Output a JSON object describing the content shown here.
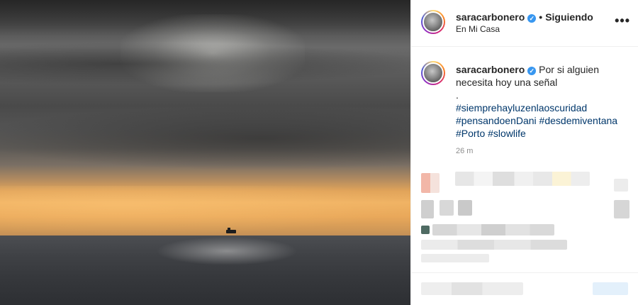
{
  "post": {
    "header": {
      "username": "saracarbonero",
      "follow_status": "Siguiendo",
      "location": "En Mi Casa",
      "more_icon": "•••"
    },
    "caption": {
      "username": "saracarbonero",
      "text": "Por si alguien necesita hoy una señal",
      "separator": ".",
      "hashtags": [
        "#siemprehayluzenlaoscuridad",
        "#pensandoenDani",
        "#desdemiventana",
        "#Porto",
        "#slowlife"
      ],
      "time": "26 m"
    },
    "icons": {
      "verified": "verified-badge-icon",
      "more": "more-options-icon"
    },
    "colors": {
      "link": "#00376b",
      "verified": "#3897f0",
      "muted": "#8e8e8e",
      "text": "#262626"
    }
  }
}
